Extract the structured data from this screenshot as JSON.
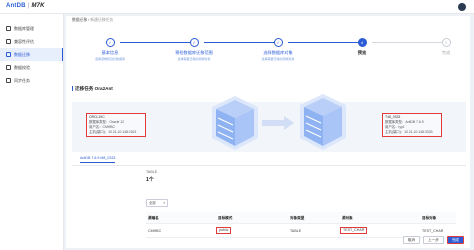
{
  "app": {
    "logo_main": "AntDB",
    "logo_sub": "M7K"
  },
  "sidebar": {
    "items": [
      {
        "label": "数据库管理"
      },
      {
        "label": "兼容性评估"
      },
      {
        "label": "数据迁移"
      },
      {
        "label": "数据校验"
      },
      {
        "label": "同步任务"
      }
    ],
    "active_index": 2
  },
  "breadcrumb": {
    "root": "数据迁移",
    "sep": "/",
    "current": "新建迁移任务"
  },
  "steps": [
    {
      "num": "1",
      "title": "基本信息",
      "sub": "选择源端和目标数据库"
    },
    {
      "num": "2",
      "title": "预检数据库迁移范围",
      "sub": "选择需要迁移的源端对象"
    },
    {
      "num": "3",
      "title": "选择数据库对象",
      "sub": "选择需要迁移的源端对象"
    },
    {
      "num": "4",
      "title": "预览",
      "sub": ""
    },
    {
      "num": "5",
      "title": "完成",
      "sub": ""
    }
  ],
  "task": {
    "title": "迁移任务 Ora2Ant"
  },
  "source": {
    "name": "ORCL19C",
    "db_type_label": "数据库类型：Oracle 12",
    "user_label": "用户名：CMHBC",
    "host_label": "主机(端口)：10.21.10.148:1521"
  },
  "target": {
    "name": "T48_0333",
    "db_type_label": "数据库类型：AntDB 7.6.9",
    "user_label": "用户名：lyp1",
    "host_label": "主机(端口)：10.21.10.148:3333"
  },
  "tab": {
    "label": "AntDB 7.6.9 M8_0333"
  },
  "stat": {
    "label": "TABLE",
    "value": "1个"
  },
  "filter": {
    "selected": "全部"
  },
  "table": {
    "headers": [
      "源端名",
      "目标模式",
      "对象类型",
      "源对象",
      "目标对象"
    ],
    "rows": [
      [
        "CMHBC",
        "public",
        "TABLE",
        "TEST_CHAR",
        "TEST_CHAR"
      ]
    ]
  },
  "buttons": {
    "cancel": "取消",
    "prev": "上一步",
    "finish": "完成"
  },
  "colors": {
    "accent": "#2b5cd6",
    "highlight": "#e23b3b"
  }
}
